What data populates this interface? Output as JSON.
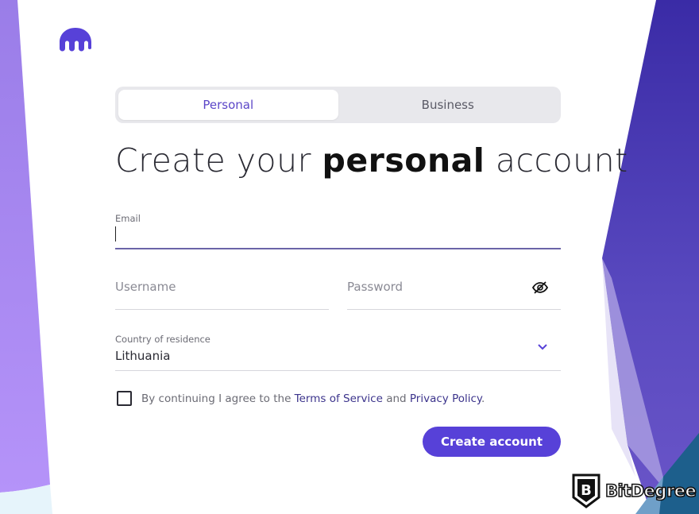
{
  "brand": {
    "logo_icon": "kraken-logo-icon",
    "accent_color": "#5741d8"
  },
  "tabs": [
    {
      "label": "Personal",
      "active": true
    },
    {
      "label": "Business",
      "active": false
    }
  ],
  "heading": {
    "part1": "Create your ",
    "emphasis": "personal",
    "part2": " account"
  },
  "form": {
    "email": {
      "label": "Email",
      "value": ""
    },
    "username": {
      "placeholder": "Username"
    },
    "password": {
      "placeholder": "Password",
      "toggle_icon": "eye-slash-icon"
    },
    "country": {
      "label": "Country of residence",
      "value": "Lithuania",
      "icon": "chevron-down-icon"
    }
  },
  "consent": {
    "text_before": "By continuing I agree to the ",
    "terms_link": "Terms of Service",
    "text_mid": " and ",
    "privacy_link": "Privacy Policy",
    "text_after": "."
  },
  "submit_label": "Create account",
  "watermark": {
    "label": "BitDegree",
    "icon": "bitdegree-shield-icon"
  }
}
